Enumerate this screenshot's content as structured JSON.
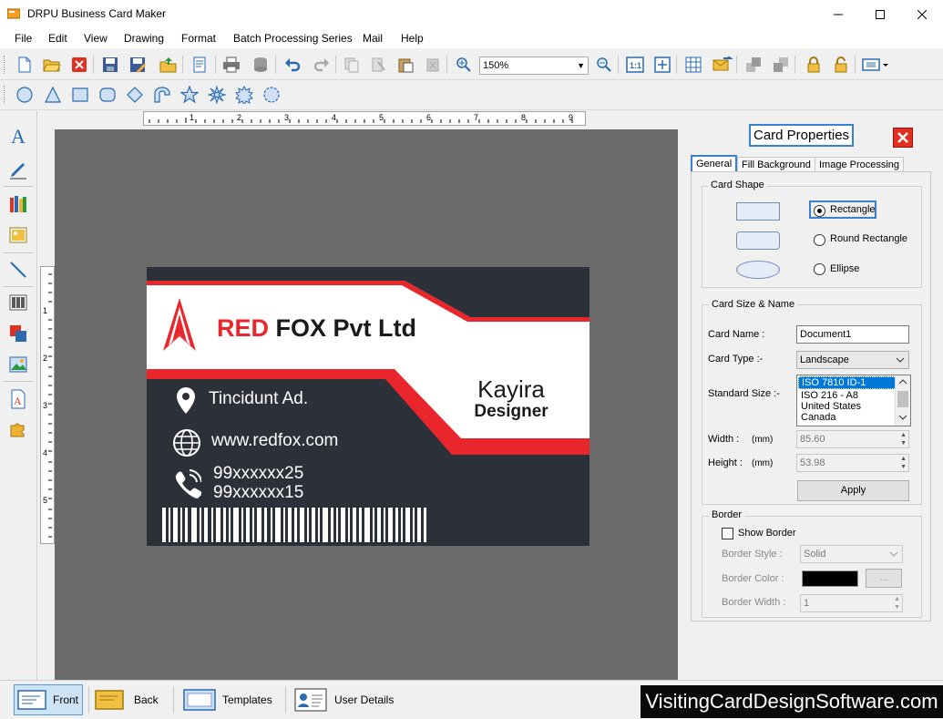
{
  "window": {
    "title": "DRPU Business Card Maker",
    "controls": [
      "–",
      "☐",
      "✕"
    ]
  },
  "menu": [
    "File",
    "Edit",
    "View",
    "Drawing",
    "Format",
    "Batch Processing Series",
    "Mail",
    "Help"
  ],
  "toolbar": {
    "zoom_value": "150%"
  },
  "ruler": {
    "h_labels": [
      "1",
      "2",
      "3",
      "4",
      "5",
      "6",
      "7",
      "8",
      "9"
    ],
    "v_labels": [
      "1",
      "2",
      "3",
      "4",
      "5"
    ]
  },
  "card": {
    "company_red": "RED",
    "company_rest": "FOX Pvt Ltd",
    "address": "Tincidunt Ad.",
    "website": "www.redfox.com",
    "phone1": "99xxxxxx25",
    "phone2": "99xxxxxx15",
    "name": "Kayira",
    "role": "Designer",
    "colors": {
      "accent": "#e8262c",
      "dark": "#2c3038",
      "white": "#ffffff"
    }
  },
  "properties": {
    "title": "Card Properties",
    "tabs": [
      "General",
      "Fill Background",
      "Image Processing"
    ],
    "card_shape": {
      "legend": "Card Shape",
      "options": [
        "Rectangle",
        "Round Rectangle",
        "Ellipse"
      ],
      "selected": "Rectangle"
    },
    "size_name": {
      "legend": "Card Size & Name",
      "card_name_label": "Card Name :",
      "card_name_value": "Document1",
      "card_type_label": "Card Type :-",
      "card_type_value": "Landscape",
      "standard_size_label": "Standard Size :-",
      "standard_sizes": [
        "ISO 7810 ID-1",
        "ISO 216 - A8",
        "United States",
        "Canada"
      ],
      "width_label": "Width :",
      "height_label": "Height :",
      "unit": "(mm)",
      "width_value": "85.60",
      "height_value": "53.98",
      "apply_label": "Apply"
    },
    "border": {
      "legend": "Border",
      "show_border_label": "Show Border",
      "style_label": "Border Style :",
      "style_value": "Solid",
      "color_label": "Border Color :",
      "color_button": "...",
      "width_label": "Border Width :",
      "width_value": "1"
    }
  },
  "bottom": {
    "front": "Front",
    "back": "Back",
    "templates": "Templates",
    "user_details": "User Details",
    "brand": "VisitingCardDesignSoftware.com"
  }
}
